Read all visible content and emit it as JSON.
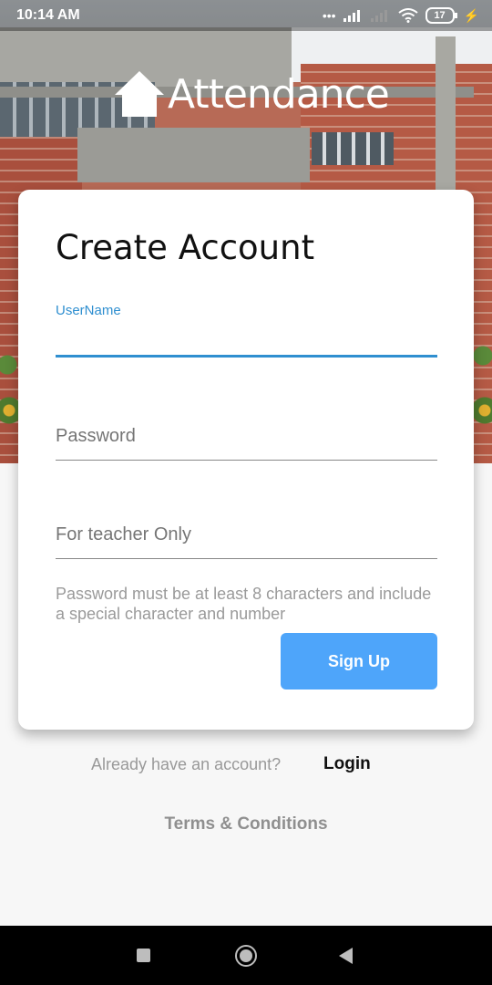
{
  "status_bar": {
    "time": "10:14 AM",
    "signal_text": "•••",
    "battery": "17"
  },
  "app": {
    "title": "Attendance",
    "icon": "home-icon"
  },
  "form": {
    "heading": "Create Account",
    "username_label": "UserName",
    "username_value": "",
    "password_placeholder": "Password",
    "teacher_placeholder": "For teacher Only",
    "hint": "Password must be at least 8 characters and include a special character and number",
    "signup_label": "Sign Up"
  },
  "footer": {
    "already_text": "Already have an account?",
    "login_label": "Login",
    "terms_label": "Terms & Conditions"
  },
  "colors": {
    "accent": "#2f8fd0",
    "button": "#4ea5fa"
  }
}
